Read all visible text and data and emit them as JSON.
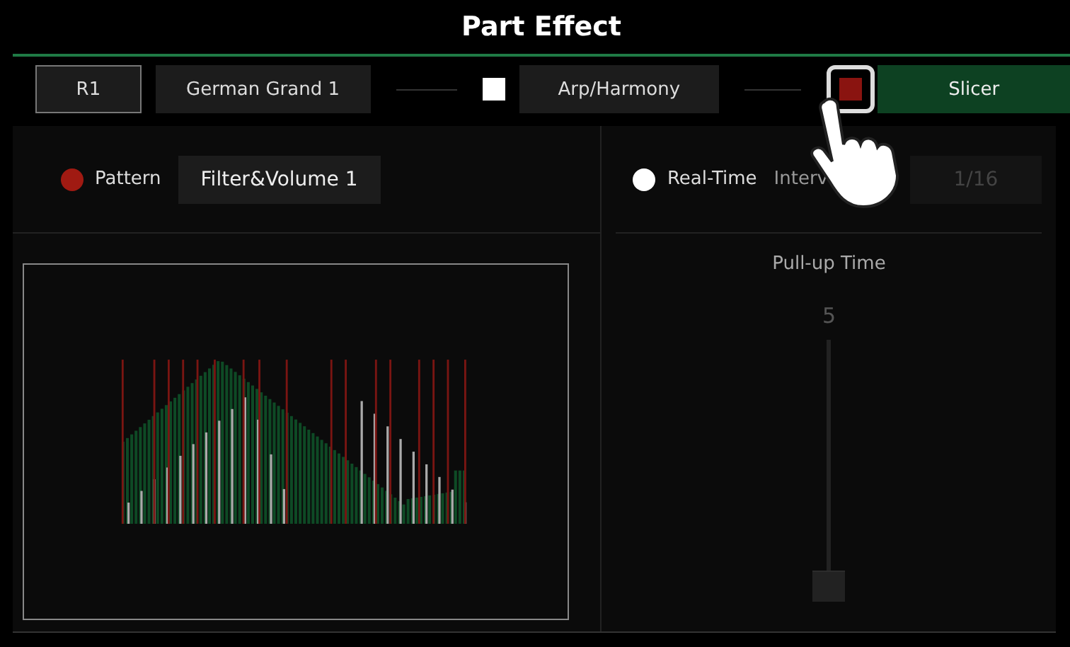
{
  "window": {
    "title": "Part Effect"
  },
  "toolbar": {
    "part": "R1",
    "voice": "German Grand 1",
    "arp": {
      "on": false,
      "label": "Arp/Harmony"
    },
    "slicer": {
      "on": true,
      "label": "Slicer",
      "selected": true
    }
  },
  "modes": [
    {
      "kind": "pattern",
      "label": "Pattern",
      "selected": true,
      "value": "Filter&Volume 1"
    },
    {
      "kind": "realtime",
      "label": "Real-Time",
      "selected": false,
      "sublabel": "Interv",
      "value": "1/16",
      "disabled": true
    }
  ],
  "pull_up": {
    "label": "Pull-up Time",
    "reading": "5",
    "level": 0
  }
}
